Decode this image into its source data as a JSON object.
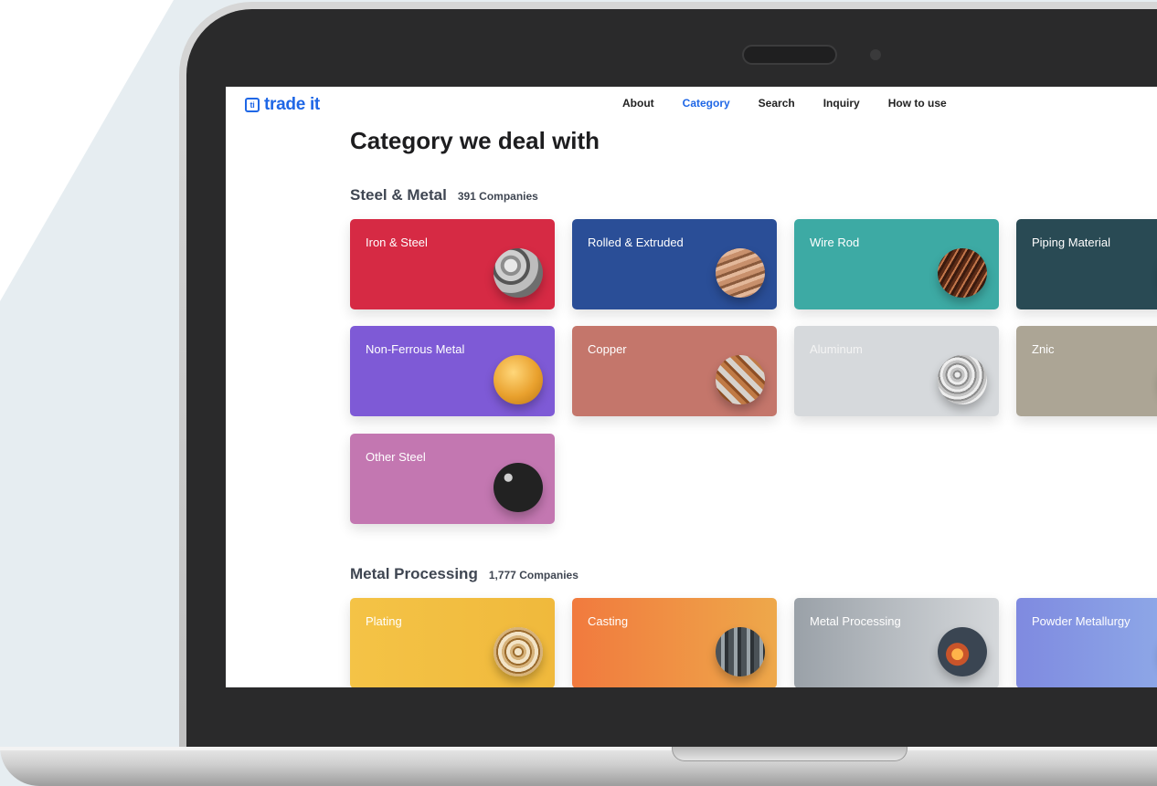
{
  "brand": {
    "logo_mark": "ti",
    "name": "trade it"
  },
  "nav": {
    "items": [
      {
        "label": "About",
        "active": false
      },
      {
        "label": "Category",
        "active": true
      },
      {
        "label": "Search",
        "active": false
      },
      {
        "label": "Inquiry",
        "active": false
      },
      {
        "label": "How to use",
        "active": false
      }
    ]
  },
  "page": {
    "title": "Category we deal with"
  },
  "sections": [
    {
      "name": "Steel & Metal",
      "count": "391 Companies",
      "cards": [
        {
          "label": "Iron & Steel",
          "color": "#d62a44",
          "icon": "steel-pipes-icon"
        },
        {
          "label": "Rolled & Extruded",
          "color": "#2a4e97",
          "icon": "rolled-sheets-icon"
        },
        {
          "label": "Wire Rod",
          "color": "#3daaa4",
          "icon": "copper-wire-icon"
        },
        {
          "label": "Piping Material",
          "color": "#294a54",
          "icon": "piping-icon"
        },
        {
          "label": "Non-Ferrous Metal",
          "color": "#7e5ad6",
          "icon": "gold-sphere-icon"
        },
        {
          "label": "Copper",
          "color": "#c4766b",
          "icon": "copper-tubes-icon"
        },
        {
          "label": "Aluminum",
          "color": "#d6d9dc",
          "icon": "aluminum-scrap-icon"
        },
        {
          "label": "Znic",
          "color": "#aca595",
          "icon": "zinc-icon"
        },
        {
          "label": "Other Steel",
          "color": "#c377b1",
          "icon": "steel-bars-icon"
        }
      ]
    },
    {
      "name": "Metal Processing",
      "count": "1,777 Companies",
      "cards": [
        {
          "label": "Plating",
          "color": "#f4c346",
          "icon": "plated-parts-icon"
        },
        {
          "label": "Casting",
          "color": "#f17a3e",
          "icon": "casting-icon"
        },
        {
          "label": "Metal Processing",
          "color": "#9aa1a8",
          "icon": "metal-grinding-icon"
        },
        {
          "label": "Powder Metallurgy",
          "color": "#7f8ae0",
          "icon": "powder-icon"
        }
      ]
    }
  ]
}
